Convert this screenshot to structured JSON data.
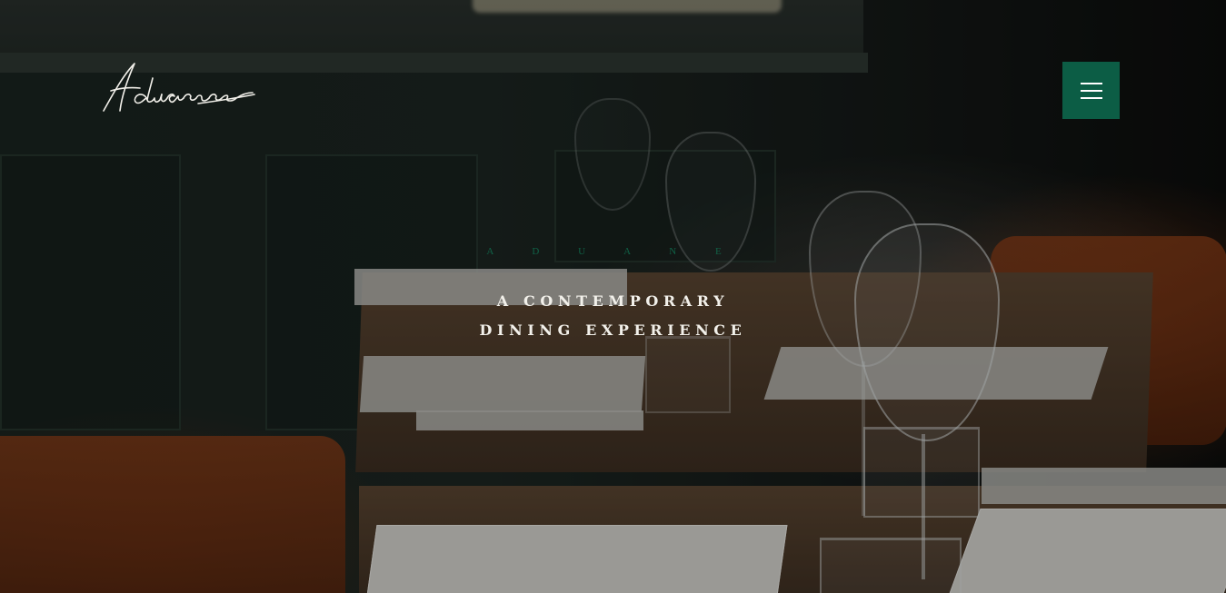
{
  "brand": {
    "logo_text": "Aduane"
  },
  "nav": {
    "menu_icon": "hamburger-menu-icon",
    "menu_color": "#0c5d45"
  },
  "hero": {
    "eyebrow": "A D U A N E",
    "headline_line1": "A CONTEMPORARY",
    "headline_line2": "DINING EXPERIENCE"
  }
}
